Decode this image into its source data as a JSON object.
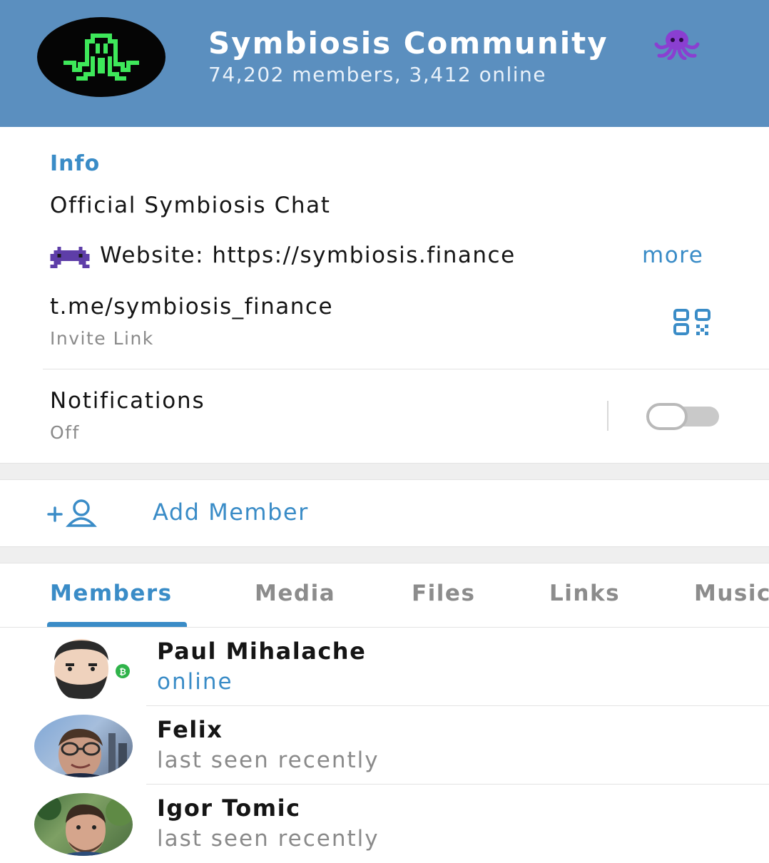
{
  "header": {
    "title": "Symbiosis Community",
    "subtitle": "74,202 members, 3,412 online",
    "background_color": "#5b8fbf",
    "avatar_icon": "octopus-pixel-logo",
    "title_emoji": "octopus-emoji"
  },
  "info": {
    "section_label": "Info",
    "description": "Official Symbiosis Chat",
    "website_emoji": "alien-monster-emoji",
    "website_text": "Website: https://symbiosis.finance",
    "more_label": "more",
    "invite_link": "t.me/symbiosis_finance",
    "invite_caption": "Invite Link",
    "qr_icon": "qr-code-icon"
  },
  "notifications": {
    "label": "Notifications",
    "state": "Off",
    "enabled": false
  },
  "add_member": {
    "label": "Add Member",
    "icon": "add-user-icon"
  },
  "tabs": [
    {
      "label": "Members",
      "active": true
    },
    {
      "label": "Media",
      "active": false
    },
    {
      "label": "Files",
      "active": false
    },
    {
      "label": "Links",
      "active": false
    },
    {
      "label": "Music",
      "active": false
    }
  ],
  "members": [
    {
      "name": "Paul Mihalache",
      "status": "online",
      "online": true
    },
    {
      "name": "Felix",
      "status": "last seen recently",
      "online": false
    },
    {
      "name": "Igor Tomic",
      "status": "last seen recently",
      "online": false
    }
  ],
  "colors": {
    "accent": "#3a8cc7",
    "logo_green": "#3ee85a",
    "muted_text": "#8a8a8a"
  }
}
